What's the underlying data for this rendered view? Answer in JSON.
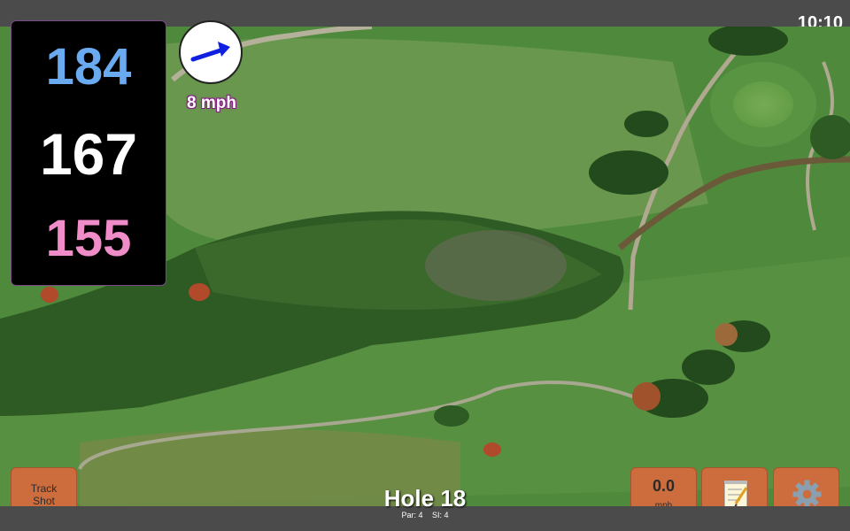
{
  "status_bar": {
    "clock": "10:10"
  },
  "distances": {
    "back": "184",
    "middle": "167",
    "front": "155"
  },
  "wind": {
    "speed": "8 mph",
    "arrow_icon": "wind-arrow-icon"
  },
  "buttons": {
    "track_shot_line1": "Track",
    "track_shot_line2": "Shot",
    "speed_value": "0.0",
    "speed_unit": "mph",
    "notes_icon": "notepad-icon",
    "settings_icon": "gear-icon"
  },
  "hole": {
    "title": "Hole 18",
    "par": "Par: 4",
    "si": "SI: 4"
  },
  "colors": {
    "back_distance": "#6aaaf0",
    "middle_distance": "#ffffff",
    "front_distance": "#f08cc8",
    "button": "#cd6d3d",
    "wind_arrow": "#1020e0"
  }
}
